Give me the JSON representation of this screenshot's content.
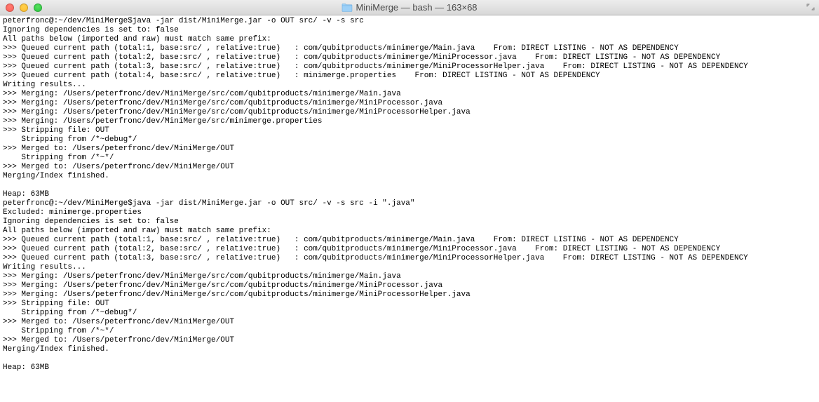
{
  "window": {
    "title": "MiniMerge — bash — 163×68"
  },
  "terminal": {
    "lines": [
      "peterfronc@:~/dev/MiniMerge$java -jar dist/MiniMerge.jar -o OUT src/ -v -s src",
      "Ignoring dependencies is set to: false",
      "All paths below (imported and raw) must match same prefix:",
      ">>> Queued current path (total:1, base:src/ , relative:true)   : com/qubitproducts/minimerge/Main.java    From: DIRECT LISTING - NOT AS DEPENDENCY",
      ">>> Queued current path (total:2, base:src/ , relative:true)   : com/qubitproducts/minimerge/MiniProcessor.java    From: DIRECT LISTING - NOT AS DEPENDENCY",
      ">>> Queued current path (total:3, base:src/ , relative:true)   : com/qubitproducts/minimerge/MiniProcessorHelper.java    From: DIRECT LISTING - NOT AS DEPENDENCY",
      ">>> Queued current path (total:4, base:src/ , relative:true)   : minimerge.properties    From: DIRECT LISTING - NOT AS DEPENDENCY",
      "Writing results...",
      ">>> Merging: /Users/peterfronc/dev/MiniMerge/src/com/qubitproducts/minimerge/Main.java",
      ">>> Merging: /Users/peterfronc/dev/MiniMerge/src/com/qubitproducts/minimerge/MiniProcessor.java",
      ">>> Merging: /Users/peterfronc/dev/MiniMerge/src/com/qubitproducts/minimerge/MiniProcessorHelper.java",
      ">>> Merging: /Users/peterfronc/dev/MiniMerge/src/minimerge.properties",
      ">>> Stripping file: OUT",
      "    Stripping from /*~debug*/",
      ">>> Merged to: /Users/peterfronc/dev/MiniMerge/OUT",
      "    Stripping from /*~*/",
      ">>> Merged to: /Users/peterfronc/dev/MiniMerge/OUT",
      "Merging/Index finished.",
      "",
      "Heap: 63MB",
      "peterfronc@:~/dev/MiniMerge$java -jar dist/MiniMerge.jar -o OUT src/ -v -s src -i \".java\"",
      "Excluded: minimerge.properties",
      "Ignoring dependencies is set to: false",
      "All paths below (imported and raw) must match same prefix:",
      ">>> Queued current path (total:1, base:src/ , relative:true)   : com/qubitproducts/minimerge/Main.java    From: DIRECT LISTING - NOT AS DEPENDENCY",
      ">>> Queued current path (total:2, base:src/ , relative:true)   : com/qubitproducts/minimerge/MiniProcessor.java    From: DIRECT LISTING - NOT AS DEPENDENCY",
      ">>> Queued current path (total:3, base:src/ , relative:true)   : com/qubitproducts/minimerge/MiniProcessorHelper.java    From: DIRECT LISTING - NOT AS DEPENDENCY",
      "Writing results...",
      ">>> Merging: /Users/peterfronc/dev/MiniMerge/src/com/qubitproducts/minimerge/Main.java",
      ">>> Merging: /Users/peterfronc/dev/MiniMerge/src/com/qubitproducts/minimerge/MiniProcessor.java",
      ">>> Merging: /Users/peterfronc/dev/MiniMerge/src/com/qubitproducts/minimerge/MiniProcessorHelper.java",
      ">>> Stripping file: OUT",
      "    Stripping from /*~debug*/",
      ">>> Merged to: /Users/peterfronc/dev/MiniMerge/OUT",
      "    Stripping from /*~*/",
      ">>> Merged to: /Users/peterfronc/dev/MiniMerge/OUT",
      "Merging/Index finished.",
      "",
      "Heap: 63MB"
    ]
  }
}
